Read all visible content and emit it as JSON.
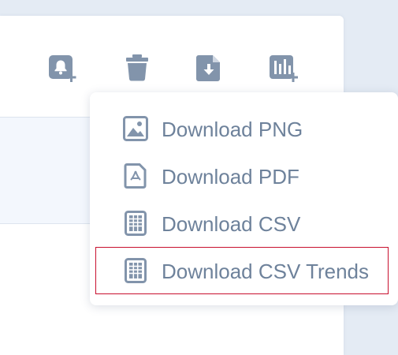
{
  "toolbar": {
    "icons": [
      {
        "name": "add-alert-icon"
      },
      {
        "name": "trash-icon"
      },
      {
        "name": "download-file-icon"
      },
      {
        "name": "add-chart-icon"
      }
    ]
  },
  "download_menu": {
    "items": [
      {
        "label": "Download PNG",
        "icon": "image-icon"
      },
      {
        "label": "Download PDF",
        "icon": "pdf-icon"
      },
      {
        "label": "Download CSV",
        "icon": "csv-icon"
      },
      {
        "label": "Download CSV Trends",
        "icon": "csv-trends-icon",
        "selected": true
      }
    ]
  },
  "colors": {
    "icon": "#8294ab",
    "text": "#6e829b",
    "highlight_border": "#c8102e",
    "background": "#e4ebf4"
  }
}
